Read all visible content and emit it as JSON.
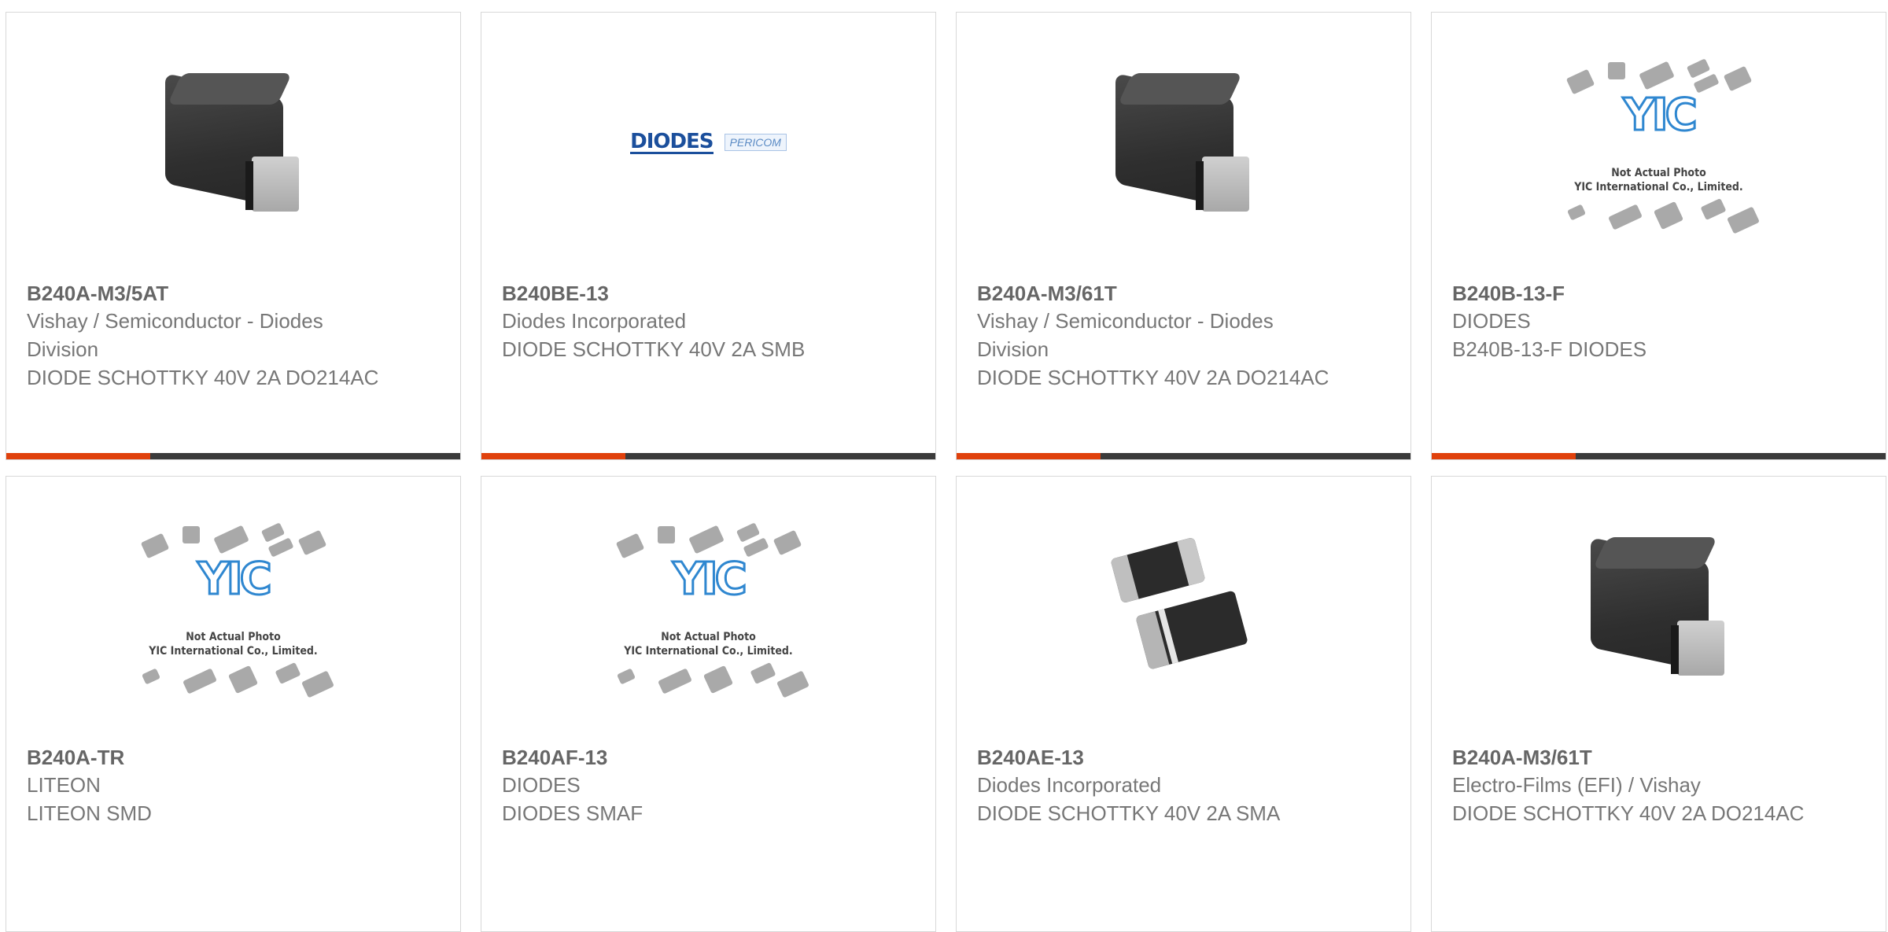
{
  "products": [
    {
      "part": "B240A-M3/5AT",
      "manufacturer": "Vishay / Semiconductor - Diodes Division",
      "description": "DIODE SCHOTTKY 40V 2A DO214AC",
      "image": "dark-smd-diode-photo"
    },
    {
      "part": "B240BE-13",
      "manufacturer": "Diodes Incorporated",
      "description": "DIODE SCHOTTKY 40V 2A SMB",
      "image": "diodes-pericom-logo"
    },
    {
      "part": "B240A-M3/61T",
      "manufacturer": "Vishay / Semiconductor - Diodes Division",
      "description": "DIODE SCHOTTKY 40V 2A DO214AC",
      "image": "dark-smd-diode-photo"
    },
    {
      "part": "B240B-13-F",
      "manufacturer": "DIODES",
      "description": "B240B-13-F DIODES",
      "image": "yic-placeholder"
    },
    {
      "part": "B240A-TR",
      "manufacturer": "LITEON",
      "description": "LITEON SMD",
      "image": "yic-placeholder"
    },
    {
      "part": "B240AF-13",
      "manufacturer": "DIODES",
      "description": "DIODES SMAF",
      "image": "yic-placeholder"
    },
    {
      "part": "B240AE-13",
      "manufacturer": "Diodes Incorporated",
      "description": "DIODE SCHOTTKY 40V 2A SMA",
      "image": "smd-pair-photo"
    },
    {
      "part": "B240A-M3/61T",
      "manufacturer": "Electro-Films (EFI) / Vishay",
      "description": "DIODE SCHOTTKY 40V 2A DO214AC",
      "image": "dark-smd-diode-photo"
    }
  ],
  "placeholder": {
    "mark": "YIC",
    "caption_line1": "Not Actual Photo",
    "caption_line2": "YIC International Co., Limited."
  },
  "logos": {
    "diodes": "DIODES",
    "pericom": "PERICOM"
  },
  "colors": {
    "accent": "#e0410c",
    "bar": "#3b3b3b",
    "text": "#777777",
    "title": "#666666",
    "logo_blue": "#1b4f9c",
    "yic_blue": "#2f87d0"
  }
}
